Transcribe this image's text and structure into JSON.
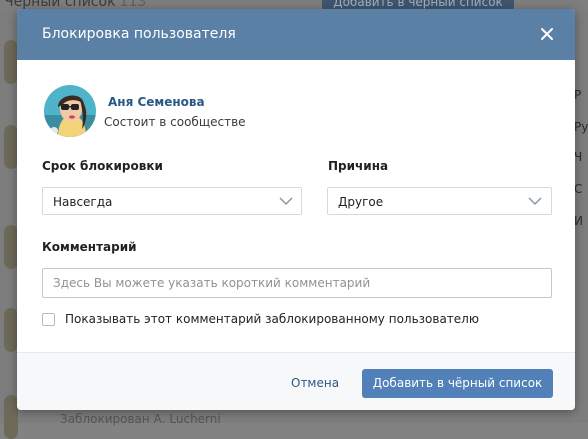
{
  "background": {
    "header_title": "Чёрный список",
    "header_count": "113",
    "header_button": "Добавить в чёрный список",
    "bottom_text": "Заблокирован А. Lucherni",
    "side_letters": [
      "Р",
      "Ру",
      "Ч",
      "С",
      "И"
    ]
  },
  "dialog": {
    "title": "Блокировка пользователя",
    "user": {
      "name": "Аня Семенова",
      "status": "Состоит в сообществе"
    },
    "duration": {
      "label": "Срок блокировки",
      "value": "Навсегда"
    },
    "reason": {
      "label": "Причина",
      "value": "Другое"
    },
    "comment": {
      "label": "Комментарий",
      "placeholder": "Здесь Вы можете указать короткий комментарий",
      "value": ""
    },
    "show_comment": {
      "label": "Показывать этот комментарий заблокированному пользователю",
      "checked": false
    },
    "buttons": {
      "cancel": "Отмена",
      "submit": "Добавить в чёрный список"
    }
  },
  "colors": {
    "header": "#5b80a6",
    "primary": "#5181b8",
    "link": "#2a5885",
    "overlay_bg": "#7d7d7d"
  },
  "icons": {
    "close": "close-icon",
    "dropdown": "chevron-down-icon"
  }
}
